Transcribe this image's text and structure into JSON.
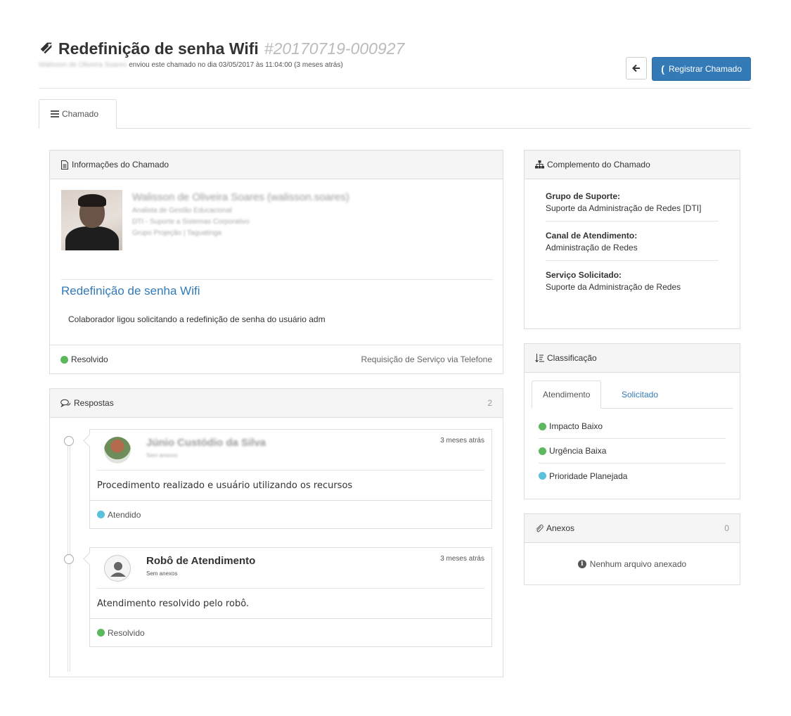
{
  "header": {
    "title": "Redefinição de senha Wifi",
    "ticket_number": "#20170719-000927",
    "submitter": "Walisson de Oliveira Soares",
    "submitted_text": "enviou este chamado no dia 03/05/2017 às 11:04:00 (3 meses atrás)",
    "back_button_icon": "arrow-left-icon",
    "register_button": "Registrar Chamado"
  },
  "tabs": [
    {
      "label": "Chamado",
      "icon": "list-icon"
    }
  ],
  "info_panel": {
    "heading": "Informações do Chamado",
    "profile": {
      "name": "Walisson de Oliveira Soares",
      "username": "(walisson.soares)",
      "role": "Analista de Gestão Educacional",
      "department": "DTI - Suporte a Sistemas Corporativo",
      "org": "Grupo Projeção | Taguatinga"
    },
    "ticket_title": "Redefinição de senha Wifi",
    "description": "Colaborador ligou solicitando a redefinição de senha do usuário adm",
    "status": "Resolvido",
    "status_color": "#5cb85c",
    "type": "Requisição de Serviço via Telefone"
  },
  "responses_panel": {
    "heading": "Respostas",
    "count": "2",
    "items": [
      {
        "author": "Júnio Custódio da Silva",
        "attachments": "Sem anexos",
        "time": "3 meses atrás",
        "message": "Procedimento realizado e usuário utilizando os recursos",
        "status": "Atendido",
        "status_color": "#5bc0de"
      },
      {
        "author": "Robô de Atendimento",
        "attachments": "Sem anexos",
        "time": "3 meses atrás",
        "message": "Atendimento resolvido pelo robô.",
        "status": "Resolvido",
        "status_color": "#5cb85c"
      }
    ]
  },
  "complement_panel": {
    "heading": "Complemento do Chamado",
    "fields": [
      {
        "label": "Grupo de Suporte:",
        "value": "Suporte da Administração de Redes [DTI]"
      },
      {
        "label": "Canal de Atendimento:",
        "value": "Administração de Redes"
      },
      {
        "label": "Serviço Solicitado:",
        "value": "Suporte da Administração de Redes"
      }
    ]
  },
  "classification_panel": {
    "heading": "Classificação",
    "tabs": [
      "Atendimento",
      "Solicitado"
    ],
    "items": [
      {
        "label": "Impacto Baixo",
        "color": "#5cb85c"
      },
      {
        "label": "Urgência Baixa",
        "color": "#5cb85c"
      },
      {
        "label": "Prioridade Planejada",
        "color": "#5bc0de"
      }
    ]
  },
  "attachments_panel": {
    "heading": "Anexos",
    "count": "0",
    "empty_text": "Nenhum arquivo anexado"
  },
  "colors": {
    "primary": "#337ab7",
    "success": "#5cb85c",
    "info": "#5bc0de"
  }
}
